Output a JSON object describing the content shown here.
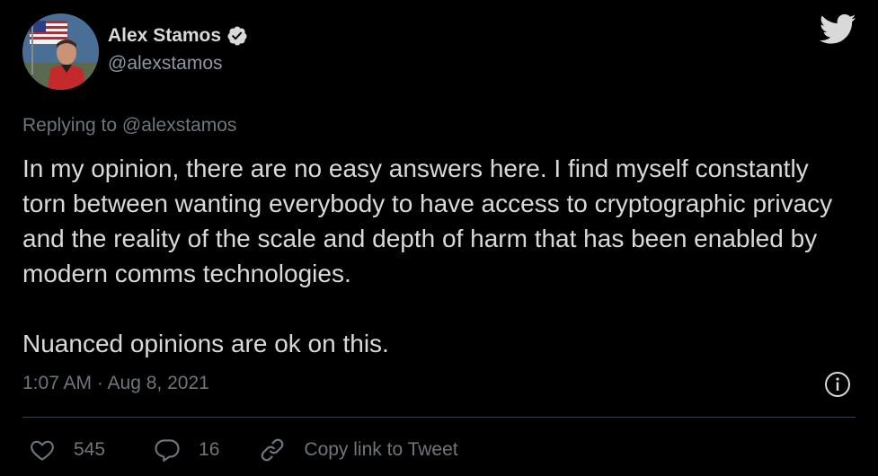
{
  "author": {
    "name": "Alex Stamos",
    "handle": "@alexstamos"
  },
  "replying_to": "Replying to @alexstamos",
  "tweet": {
    "text": "In my opinion, there are no easy answers here. I find myself constantly torn between wanting everybody to have access to cryptographic privacy and the reality of the scale and depth of harm that has been enabled by modern comms technologies.\n\nNuanced opinions are ok on this.",
    "timestamp": "1:07 AM · Aug 8, 2021"
  },
  "actions": {
    "likes": "545",
    "replies": "16",
    "copy_link": "Copy link to Tweet"
  },
  "icons": {
    "verified": "verified-badge-icon",
    "brand": "twitter-bird-icon",
    "info": "info-icon",
    "like": "heart-icon",
    "reply": "reply-bubble-icon",
    "link": "link-icon"
  },
  "colors": {
    "background": "#000000",
    "text": "#d9d9d9",
    "muted": "#6e767d",
    "divider": "#38444d"
  }
}
